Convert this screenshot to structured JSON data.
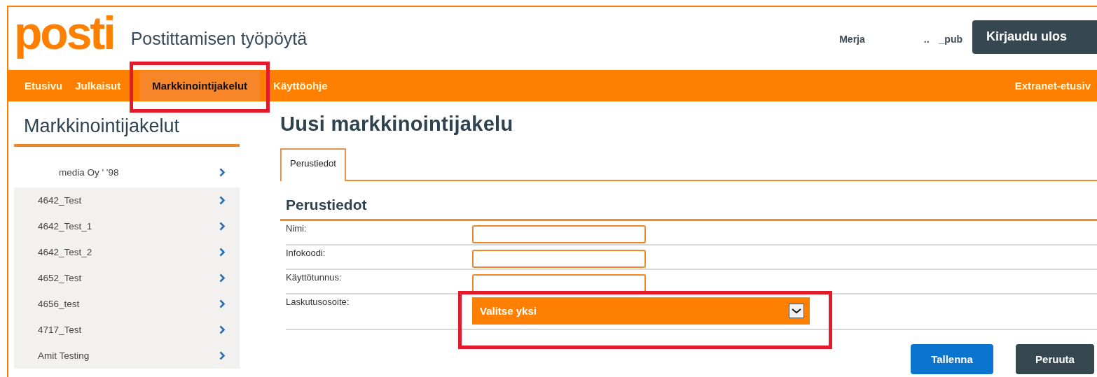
{
  "header": {
    "logo": "posti",
    "title": "Postittamisen työpöytä",
    "user": {
      "name": "Merja",
      "separator": "..",
      "account": "_pub"
    },
    "logout_button": "Kirjaudu ulos"
  },
  "nav": {
    "items": [
      {
        "label": "Etusivu",
        "selected": false,
        "highlighted": false
      },
      {
        "label": "Julkaisut",
        "selected": false,
        "highlighted": false
      },
      {
        "label": "Markkinointijakelut",
        "selected": true,
        "highlighted": true
      },
      {
        "label": "Käyttöohje",
        "selected": false,
        "highlighted": false
      }
    ],
    "right_link": "Extranet-etusiv"
  },
  "sidebar": {
    "title": "Markkinointijakelut",
    "items": [
      {
        "label": "media Oy '   '98",
        "kind": "header"
      },
      {
        "label": "4642_Test",
        "kind": "item"
      },
      {
        "label": "4642_Test_1",
        "kind": "item"
      },
      {
        "label": "4642_Test_2",
        "kind": "item"
      },
      {
        "label": "4652_Test",
        "kind": "item"
      },
      {
        "label": "4656_test",
        "kind": "item"
      },
      {
        "label": "4717_Test",
        "kind": "item"
      },
      {
        "label": "Amit Testing",
        "kind": "item"
      }
    ]
  },
  "main": {
    "title": "Uusi markkinointijakelu",
    "tabs": [
      {
        "label": "Perustiedot",
        "selected": true
      }
    ],
    "section_title": "Perustiedot",
    "fields": [
      {
        "label": "Nimi:",
        "kind": "text",
        "highlighted": false
      },
      {
        "label": "Infokoodi:",
        "kind": "text",
        "highlighted": false
      },
      {
        "label": "Käyttötunnus:",
        "kind": "text",
        "highlighted": false
      },
      {
        "label": "Laskutusosoite:",
        "kind": "select",
        "value": "Valitse yksi",
        "highlighted": true
      }
    ],
    "buttons": [
      {
        "label": "Tallenna",
        "kind": "primary"
      },
      {
        "label": "Peruuta",
        "kind": "secondary"
      }
    ]
  }
}
